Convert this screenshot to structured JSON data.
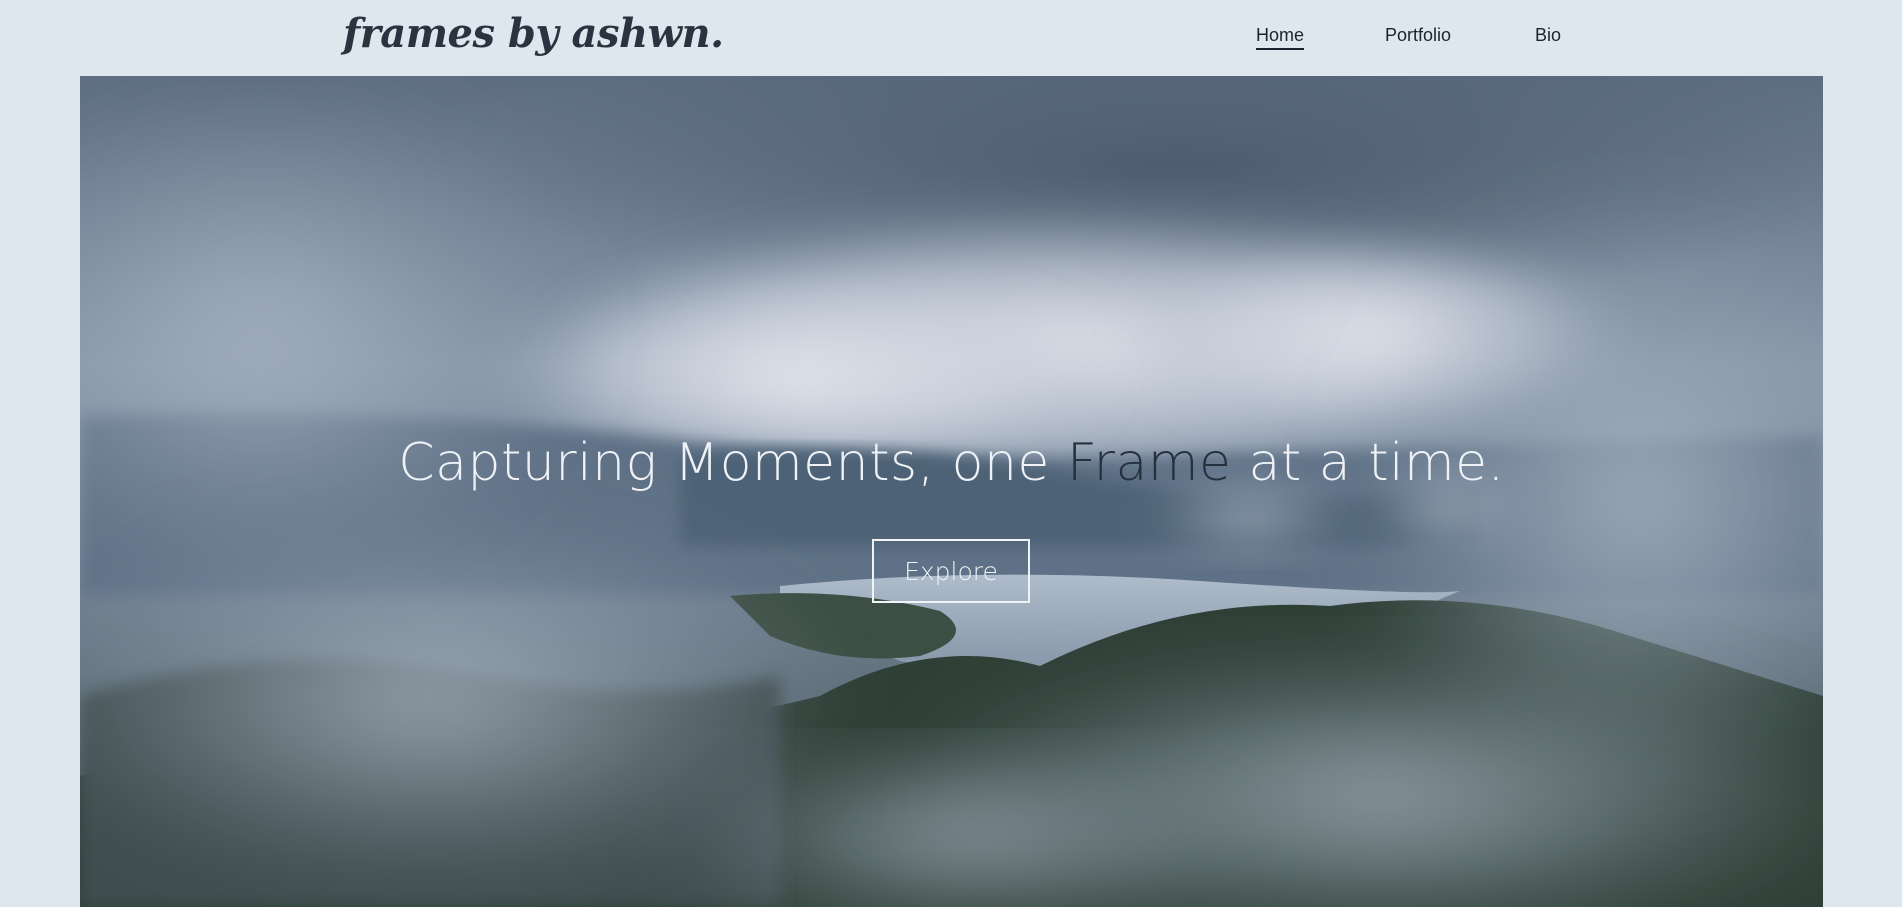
{
  "header": {
    "logo": "frames by ashwn."
  },
  "nav": {
    "items": [
      {
        "label": "Home",
        "active": true
      },
      {
        "label": "Portfolio",
        "active": false
      },
      {
        "label": "Bio",
        "active": false
      }
    ]
  },
  "hero": {
    "headline_part1": "Capturing Moments, one ",
    "headline_highlight": "Frame",
    "headline_part2": " at a time.",
    "cta_label": "Explore",
    "background_image": "misty-lake-mountains-photo"
  },
  "colors": {
    "page_bg": "#dfe7ee",
    "text_dark": "#1c2330",
    "headline_light": "#eef2f6",
    "headline_accent": "#27303d"
  }
}
